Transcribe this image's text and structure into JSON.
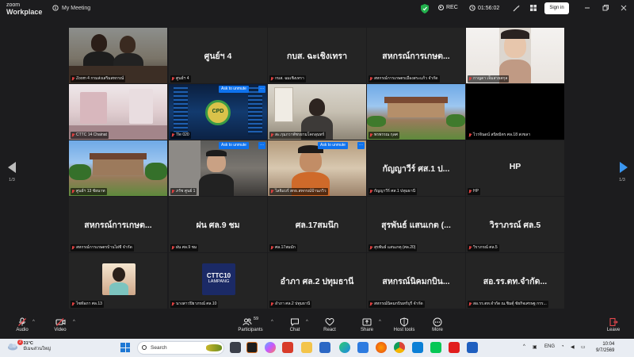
{
  "titlebar": {
    "logo_line1": "zoom",
    "logo_line2": "Workplace",
    "meeting_title": "My Meeting",
    "rec_label": "REC",
    "timer": "01:56:02",
    "signin_label": "Sign in"
  },
  "gallery": {
    "page_left": "1/3",
    "page_right": "1/3",
    "tiles": [
      {
        "caption": "Zoom 4 กรมส่งเสริมสหกรณ์",
        "name": "",
        "video": true
      },
      {
        "caption": "ศูนย์ฯ 4",
        "name": "ศูนย์ฯ 4",
        "video": false
      },
      {
        "caption": "กบส. ฉมเชิงเทรา",
        "name": "กบส. ฉะเชิงเทรา",
        "video": false
      },
      {
        "caption": "สหกรณ์การเกษตรเมืองสระแก้ว จำกัด",
        "name": "สหกรณ์การเกษต...",
        "video": false
      },
      {
        "caption": "กาญดา เจ็มสวยสกุล",
        "name": "",
        "video": true
      },
      {
        "caption": "CTTC 14 Chainat",
        "name": "",
        "video": true
      },
      {
        "caption": "Tle 020",
        "name": "",
        "video": true
      },
      {
        "caption": "สะ.กุมภวาพัชรยามโคกลุนทร์",
        "name": "",
        "video": true
      },
      {
        "caption": "พรพรรณ กุลศ",
        "name": "",
        "video": true
      },
      {
        "caption": "ไวรจินดน์ สนิทมิตร ศล.18 สงขลา",
        "name": "",
        "video": false
      },
      {
        "caption": "ศูนย์ฯ 13 ชัยนาท",
        "name": "",
        "video": true
      },
      {
        "caption": "ภรัช ศูนย์ 1",
        "name": "",
        "video": true
      },
      {
        "caption": "ไลจิแบร์ สกธ.สหกรณ์บ้านภวิว",
        "name": "",
        "video": true
      },
      {
        "caption": "กัญญาวีร์ ศส.1 ปทุมธานี",
        "name": "กัญญาวีร์ ศส.1 ป...",
        "video": false
      },
      {
        "caption": "HP",
        "name": "HP",
        "video": false
      },
      {
        "caption": "สหกรณ์การเกษตรบ้านไผ่ชี จำกัด",
        "name": "สหกรณ์การเกษต...",
        "video": false
      },
      {
        "caption": "ฝน ศล.9 ชม",
        "name": "ฝน ศล.9 ชม",
        "video": false
      },
      {
        "caption": "ศล.17สมมัก",
        "name": "ศล.17สมนึก",
        "video": false
      },
      {
        "caption": "สุรพันธ์ แสนเกตุ (ศล.20)",
        "name": "สุรพันธ์ แสนเกต (...",
        "video": false
      },
      {
        "caption": "วิราภรณ์ ศล.5",
        "name": "วิราภรณ์ ศล.5",
        "video": false
      },
      {
        "caption": "ไซทัลภา ศล.13",
        "name": "",
        "video": true
      },
      {
        "caption": "นางสาวปิยาภรณ์ ศล.10",
        "name": "",
        "video": true
      },
      {
        "caption": "อำภา ศล.2 ปทุมธานี",
        "name": "อำภา ศล.2 ปทุมธานี",
        "video": false
      },
      {
        "caption": "สหกรณ์นิคมกบินทร์บุรี จำกัด",
        "name": "สหกรณ์นิคมกบิน...",
        "video": false
      },
      {
        "caption": "สอ.รร.ตท.จำกัด ณ.ชิมตุ์ ชัยกิจเศรษฐ กรร...",
        "name": "สอ.รร.ตท.จำกัด...",
        "video": false
      }
    ],
    "ask_to_unmute": "Ask to unmute",
    "more_label": "···",
    "cttc_logo_line1": "CTTC10",
    "cttc_logo_line2": "LAMPANG",
    "cpd_logo": "CPD"
  },
  "toolbar": {
    "audio": "Audio",
    "video": "Video",
    "participants": "Participants",
    "participants_count": "59",
    "chat": "Chat",
    "react": "React",
    "share": "Share",
    "host_tools": "Host tools",
    "more": "More",
    "leave": "Leave"
  },
  "taskbar": {
    "temperature": "31°C",
    "weather_desc": "มีเมฆส่วนใหญ่",
    "search_placeholder": "Search",
    "lang": "ENG",
    "time": "10:04",
    "date": "9/7/2569",
    "notification_count": "2"
  }
}
